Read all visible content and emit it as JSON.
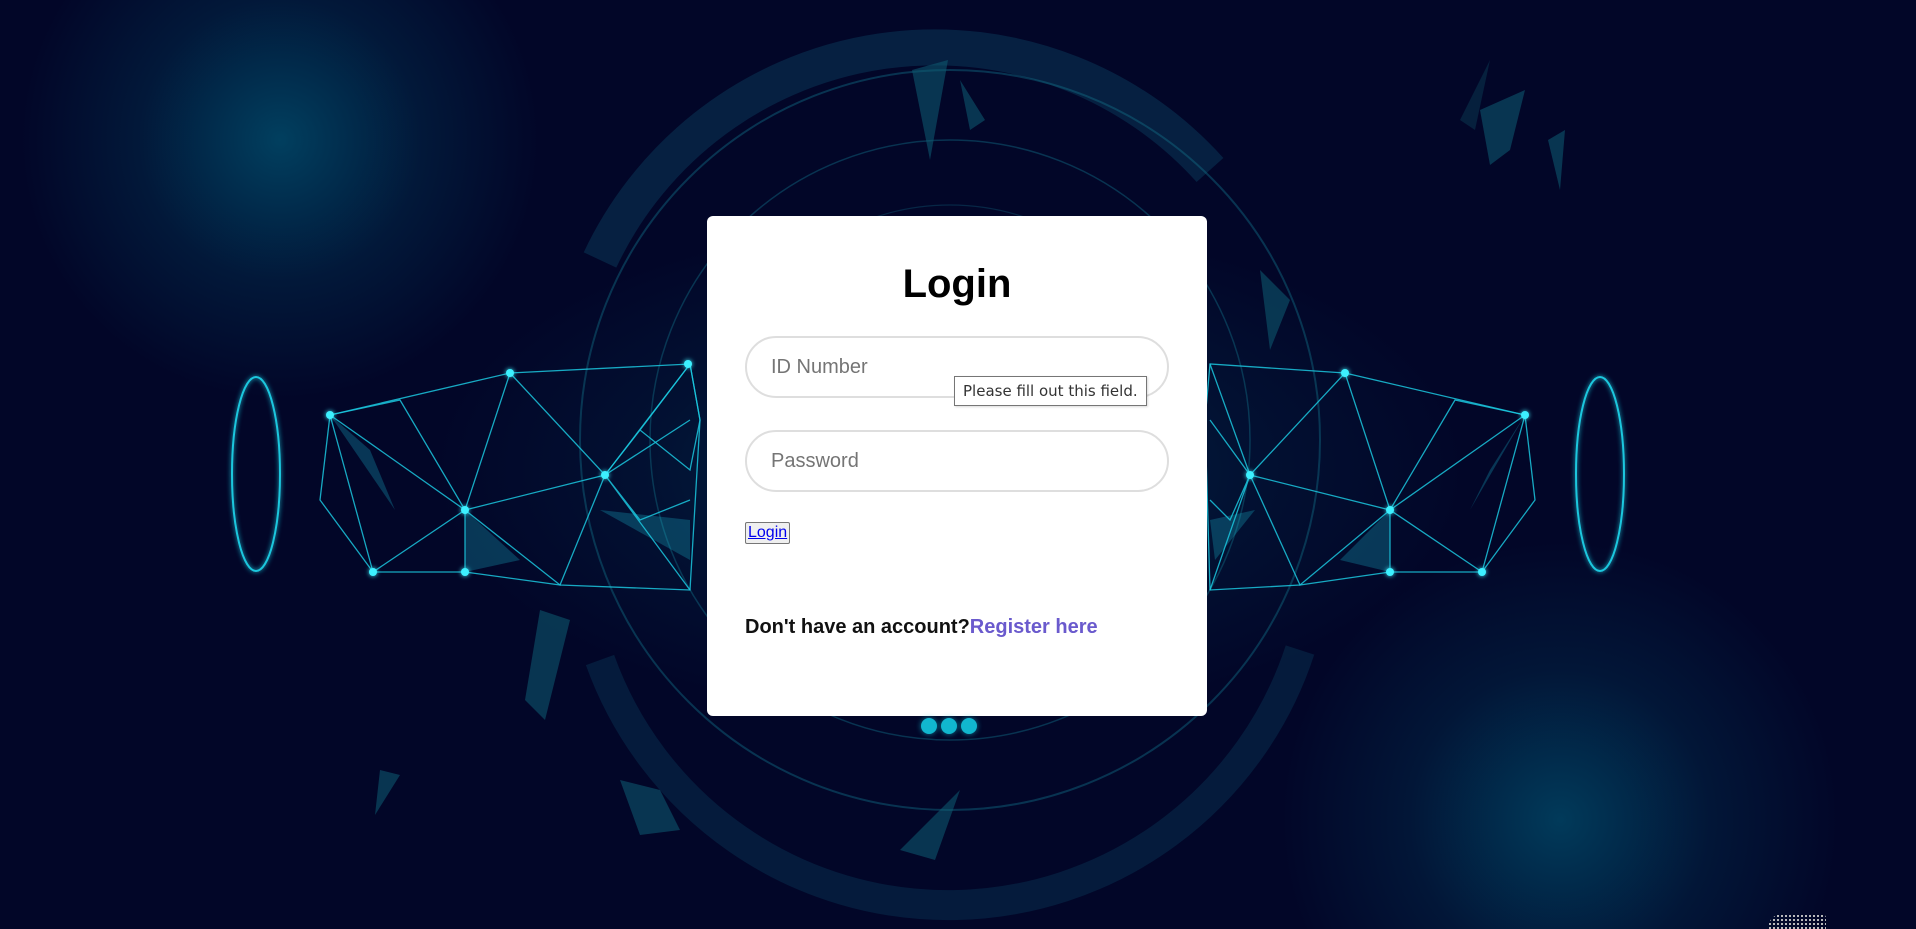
{
  "login_form": {
    "title": "Login",
    "id_field": {
      "placeholder": "ID Number",
      "value": ""
    },
    "password_field": {
      "placeholder": "Password",
      "value": ""
    },
    "validation_tooltip": "Please fill out this field.",
    "submit_label": "Login",
    "register_prompt": "Don't have an account?",
    "register_link": "Register here"
  },
  "colors": {
    "background": "#020628",
    "accent_cyan": "#11b7cf",
    "link_purple": "#6a5acd",
    "card": "#ffffff"
  },
  "decorations": {
    "background_art": "network-hands-illustration",
    "carousel_dot_icons": 3
  }
}
